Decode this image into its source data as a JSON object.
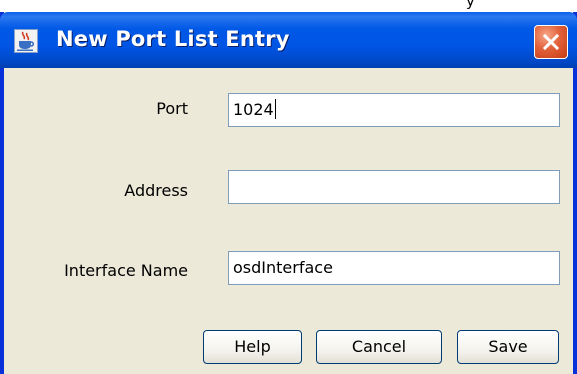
{
  "window": {
    "title": "New Port List Entry"
  },
  "desktop": {
    "partial_text": "y"
  },
  "form": {
    "port": {
      "label": "Port",
      "value": "1024"
    },
    "address": {
      "label": "Address",
      "value": ""
    },
    "interface_name": {
      "label": "Interface Name",
      "value": "osdInterface"
    }
  },
  "buttons": {
    "help": "Help",
    "cancel": "Cancel",
    "save": "Save"
  },
  "icons": {
    "title": "java-cup-icon",
    "close": "close-icon"
  },
  "colors": {
    "titlebar": "#0055e5",
    "dialog_bg": "#ece9d8",
    "close_button": "#e2613a",
    "field_border": "#7f9db9"
  }
}
